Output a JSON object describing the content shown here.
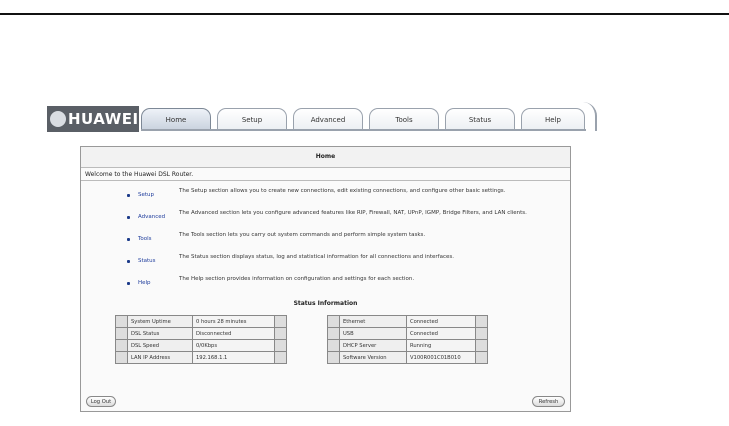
{
  "brand": {
    "name": "HUAWEI"
  },
  "nav": {
    "tabs": [
      "Home",
      "Setup",
      "Advanced",
      "Tools",
      "Status",
      "Help"
    ],
    "active": "Home"
  },
  "home": {
    "title": "Home",
    "welcome": "Welcome to the Huawei DSL Router.",
    "sections": [
      {
        "link": "Setup",
        "desc": "The Setup section allows you to create new connections, edit existing connections, and configure other basic settings."
      },
      {
        "link": "Advanced",
        "desc": "The Advanced section lets you configure advanced features like RIP, Firewall, NAT, UPnP, IGMP, Bridge Filters, and LAN clients."
      },
      {
        "link": "Tools",
        "desc": "The Tools section lets you carry out system commands and perform simple system tasks."
      },
      {
        "link": "Status",
        "desc": "The Status section displays status, log and statistical information for all connections and interfaces."
      },
      {
        "link": "Help",
        "desc": "The Help section provides information on configuration and settings for each section."
      }
    ],
    "status_title": "Status Information",
    "status_left": [
      {
        "label": "System Uptime",
        "value": "0 hours 28 minutes"
      },
      {
        "label": "DSL Status",
        "value": "Disconnected"
      },
      {
        "label": "DSL Speed",
        "value": "0/0Kbps"
      },
      {
        "label": "LAN IP Address",
        "value": "192.168.1.1"
      }
    ],
    "status_right": [
      {
        "label": "Ethernet",
        "value": "Connected"
      },
      {
        "label": "USB",
        "value": "Connected"
      },
      {
        "label": "DHCP Server",
        "value": "Running"
      },
      {
        "label": "Software Version",
        "value": "V100R001C01B010"
      }
    ],
    "logout_label": "Log Out",
    "refresh_label": "Refresh"
  }
}
